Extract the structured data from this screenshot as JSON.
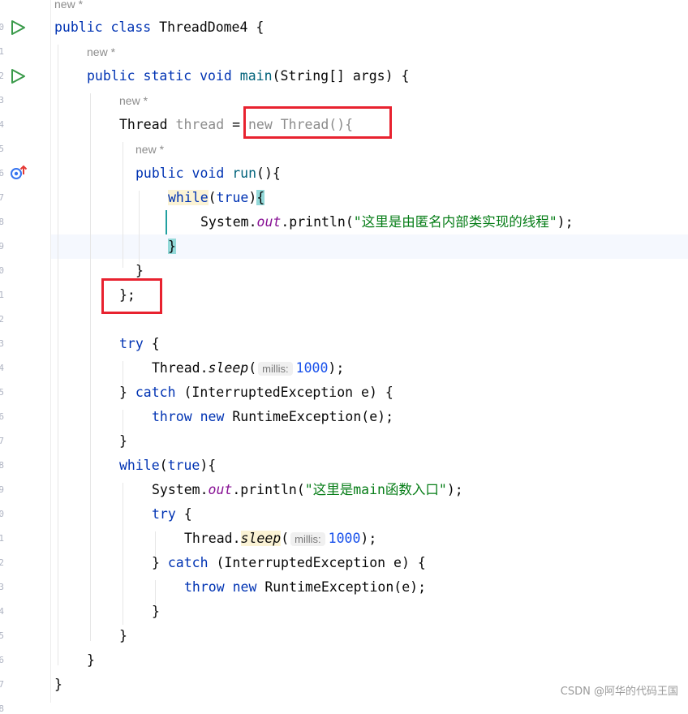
{
  "hints": {
    "new_label": "new *"
  },
  "code": {
    "class_decl": {
      "kw1": "public",
      "kw2": "class",
      "name": "ThreadDome4",
      "brace": " {"
    },
    "main_decl": {
      "kw1": "public",
      "kw2": "static",
      "kw3": "void",
      "name": "main",
      "params": "(String[] args) {"
    },
    "thread_decl": {
      "type": "Thread ",
      "var": "thread",
      "eq": " = ",
      "anon": "new Thread(){"
    },
    "run_decl": {
      "kw1": "public",
      "kw2": "void",
      "name": "run",
      "rest": "(){"
    },
    "while1": {
      "kw": "while",
      "open": "(",
      "val": "true",
      "close": ")",
      "brace": "{"
    },
    "println1": {
      "obj": "System.",
      "field": "out",
      "method": ".println(",
      "str": "\"这里是由匿名内部类实现的线程\"",
      "end": ");"
    },
    "close_brace": "}",
    "anon_close": "};",
    "try_kw": "try",
    "brace_open": " {",
    "sleep1": {
      "obj": "Thread.",
      "method": "sleep",
      "open": "(",
      "hint": "millis:",
      "num": "1000",
      "end": ");"
    },
    "catch_line": {
      "close": "} ",
      "kw": "catch",
      "rest": " (InterruptedException e) {"
    },
    "throw_line": {
      "kw1": "throw",
      "kw2": "new",
      "rest": " RuntimeException(e);"
    },
    "while2": {
      "kw": "while",
      "open": "(",
      "val": "true",
      "rest": "){"
    },
    "println2": {
      "obj": "System.",
      "field": "out",
      "method": ".println(",
      "str": "\"这里是main函数入口\"",
      "end": ");"
    },
    "sleep2": {
      "obj": "Thread.",
      "method": "sleep",
      "open": "(",
      "hint": "millis:",
      "num": "1000",
      "end": ");"
    }
  },
  "line_numbers": [
    "0",
    "1",
    "2",
    "3",
    "4",
    "5",
    "6",
    "7",
    "8",
    "9",
    "0",
    "1",
    "2",
    "3",
    "4",
    "5",
    "6",
    "7",
    "8",
    "9",
    "0",
    "1",
    "2",
    "3",
    "4",
    "5",
    "6",
    "7",
    "8"
  ],
  "watermark": "CSDN @阿华的代码王国",
  "colors": {
    "keyword": "#0033b3",
    "string": "#067d17",
    "number": "#1750eb",
    "field": "#871094",
    "highlight_box": "#e8222f",
    "run_icon": "#3a9a4a"
  },
  "icons": [
    "run-icon",
    "run-icon",
    "override-icon"
  ]
}
